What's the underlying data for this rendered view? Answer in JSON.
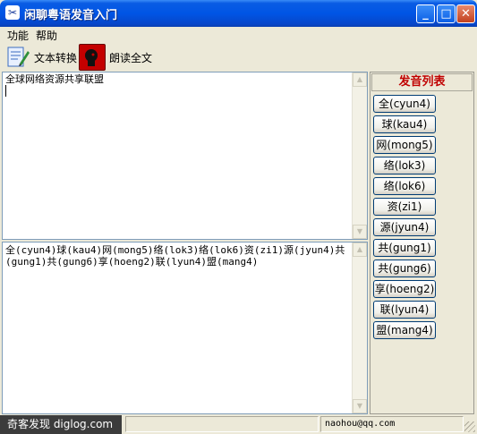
{
  "window": {
    "title": "闲聊粤语发音入门",
    "icon": "app-icon",
    "controls": {
      "minimize": "_",
      "maximize": "□",
      "close": "✕"
    }
  },
  "menu": {
    "items": [
      "功能",
      "帮助"
    ]
  },
  "toolbar": {
    "convert_label": "文本转换",
    "read_label": "朗读全文"
  },
  "input_text": "全球网络资源共享联盟",
  "output_text": "全(cyun4)球(kau4)网(mong5)络(lok3)络(lok6)资(zi1)源(jyun4)共(gung1)共(gung6)享(hoeng2)联(lyun4)盟(mang4)",
  "pronunciation_panel": {
    "header": "发音列表",
    "header_color": "#c00000",
    "items": [
      "全(cyun4)",
      "球(kau4)",
      "网(mong5)",
      "络(lok3)",
      "络(lok6)",
      "资(zi1)",
      "源(jyun4)",
      "共(gung1)",
      "共(gung6)",
      "享(hoeng2)",
      "联(lyun4)",
      "盟(mang4)"
    ]
  },
  "statusbar": {
    "email": "naohou@qq.com"
  },
  "watermark": "奇客发现 diglog.com"
}
